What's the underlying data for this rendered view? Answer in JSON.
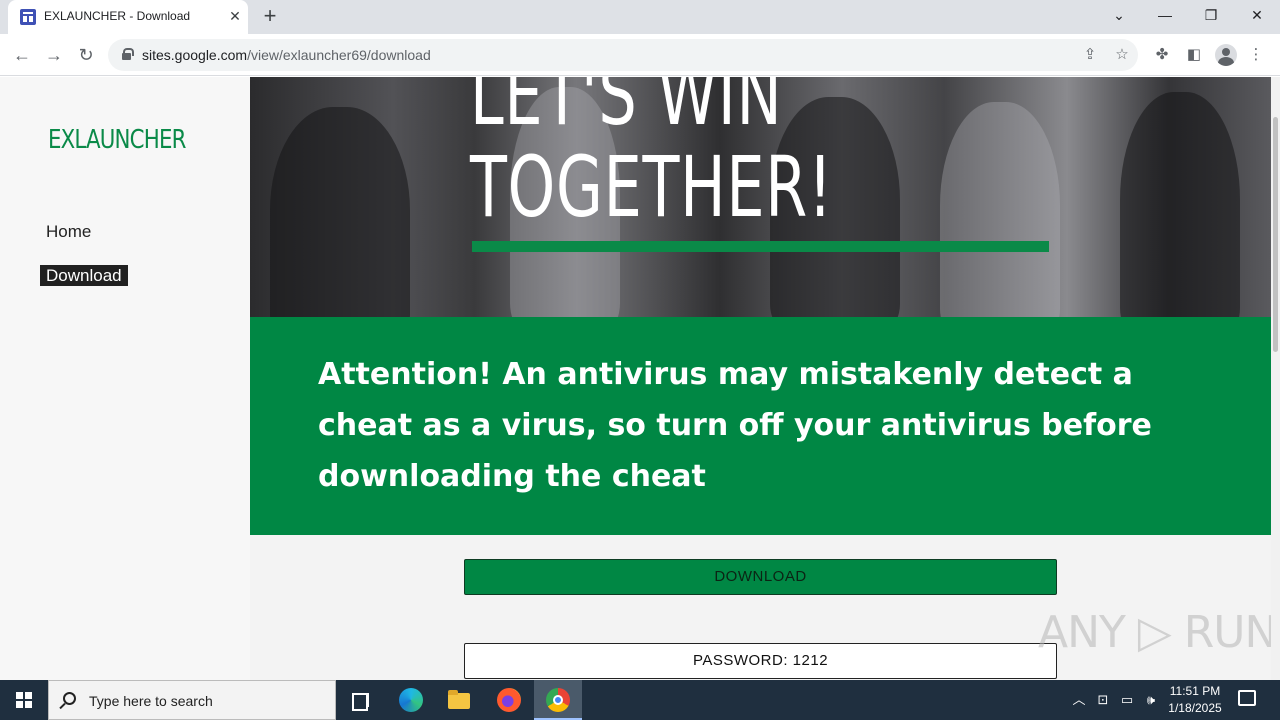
{
  "browser": {
    "tab_title": "EXLAUNCHER - Download",
    "tab_close": "✕",
    "new_tab": "+",
    "url_domain": "sites.google.com",
    "url_path": "/view/exlauncher69/download",
    "window_controls": {
      "dropdown": "⌄",
      "minimize": "—",
      "restore": "❐",
      "close": "✕"
    },
    "icons": [
      "back-icon",
      "forward-icon",
      "reload-icon",
      "lock-icon",
      "share-icon",
      "star-icon",
      "extensions-icon",
      "side-panel-icon",
      "profile-icon",
      "menu-icon"
    ]
  },
  "site": {
    "brand": "EXLAUNCHER",
    "nav": [
      {
        "label": "Home",
        "active": false
      },
      {
        "label": "Download",
        "active": true
      }
    ],
    "hero": {
      "line1": "LET'S WIN",
      "line2": "TOGETHER!"
    },
    "banner_text": "Attention! An antivirus may mistakenly detect a cheat as a virus, so turn off your antivirus before downloading the cheat",
    "download_button": "DOWNLOAD",
    "password_button": "PASSWORD: 1212",
    "info_icon": "i",
    "watermark": "ANY ▷ RUN"
  },
  "colors": {
    "brand_green": "#008744",
    "sidebar_bg": "#f7f7f7",
    "taskbar_bg": "#1f2f3f"
  },
  "taskbar": {
    "search_placeholder": "Type here to search",
    "time": "11:51 PM",
    "date": "1/18/2025",
    "apps": [
      "task-view-icon",
      "edge-icon",
      "file-explorer-icon",
      "firefox-icon",
      "chrome-icon"
    ],
    "tray": [
      "chevron-up-icon",
      "network-icon",
      "monitor-icon",
      "volume-icon"
    ]
  }
}
